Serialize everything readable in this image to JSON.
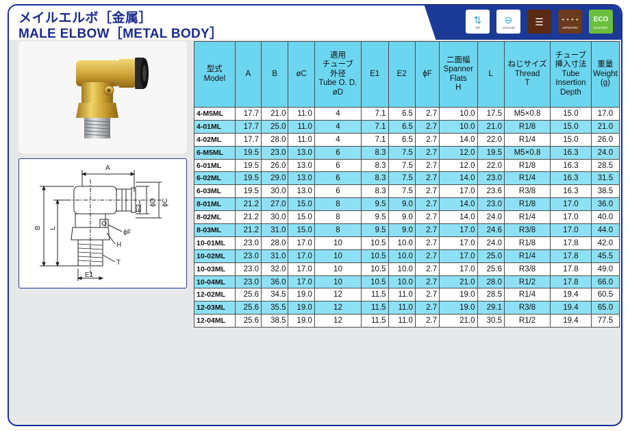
{
  "header": {
    "title_jp": "メイルエルボ［金属］",
    "title_en": "MALE ELBOW［METAL BODY］"
  },
  "icons": [
    {
      "name": "air-icon",
      "label": "AIR"
    },
    {
      "name": "vacuum-icon",
      "label": "VACUUM"
    },
    {
      "name": "multi-icon",
      "label": ""
    },
    {
      "name": "antistatic-icon",
      "label": "ANTISTATIC"
    },
    {
      "name": "ecology-icon",
      "label": "ECOLOGY"
    }
  ],
  "table": {
    "headers": [
      "型式\nModel",
      "A",
      "B",
      "øC",
      "適用\nチューブ\n外径\nTube O. D.\nøD",
      "E1",
      "E2",
      "ϕF",
      "二面幅\nSpanner\nFlats\nH",
      "L",
      "ねじサイズ\nThread\nT",
      "チューブ\n挿入寸法\nTube\nInsertion\nDepth",
      "重量\nWeight\n(g)"
    ],
    "rows": [
      [
        "4-M5ML",
        "17.7",
        "21.0",
        "11.0",
        "4",
        "7.1",
        "6.5",
        "2.7",
        "10.0",
        "17.5",
        "M5×0.8",
        "15.0",
        "17.0"
      ],
      [
        "4-01ML",
        "17.7",
        "25.0",
        "11.0",
        "4",
        "7.1",
        "6.5",
        "2.7",
        "10.0",
        "21.0",
        "R1/8",
        "15.0",
        "21.0"
      ],
      [
        "4-02ML",
        "17.7",
        "28.0",
        "11.0",
        "4",
        "7.1",
        "6.5",
        "2.7",
        "14.0",
        "22.0",
        "R1/4",
        "15.0",
        "26.0"
      ],
      [
        "6-M5ML",
        "19.5",
        "23.0",
        "13.0",
        "6",
        "8.3",
        "7.5",
        "2.7",
        "12.0",
        "19.5",
        "M5×0.8",
        "16.3",
        "24.0"
      ],
      [
        "6-01ML",
        "19.5",
        "26.0",
        "13.0",
        "6",
        "8.3",
        "7.5",
        "2.7",
        "12.0",
        "22.0",
        "R1/8",
        "16.3",
        "28.5"
      ],
      [
        "6-02ML",
        "19.5",
        "29.0",
        "13.0",
        "6",
        "8.3",
        "7.5",
        "2.7",
        "14.0",
        "23.0",
        "R1/4",
        "16.3",
        "31.5"
      ],
      [
        "6-03ML",
        "19.5",
        "30.0",
        "13.0",
        "6",
        "8.3",
        "7.5",
        "2.7",
        "17.0",
        "23.6",
        "R3/8",
        "16.3",
        "38.5"
      ],
      [
        "8-01ML",
        "21.2",
        "27.0",
        "15.0",
        "8",
        "9.5",
        "9.0",
        "2.7",
        "14.0",
        "23.0",
        "R1/8",
        "17.0",
        "36.0"
      ],
      [
        "8-02ML",
        "21.2",
        "30.0",
        "15.0",
        "8",
        "9.5",
        "9.0",
        "2.7",
        "14.0",
        "24.0",
        "R1/4",
        "17.0",
        "40.0"
      ],
      [
        "8-03ML",
        "21.2",
        "31.0",
        "15.0",
        "8",
        "9.5",
        "9.0",
        "2.7",
        "17.0",
        "24.6",
        "R3/8",
        "17.0",
        "44.0"
      ],
      [
        "10-01ML",
        "23.0",
        "28.0",
        "17.0",
        "10",
        "10.5",
        "10.0",
        "2.7",
        "17.0",
        "24.0",
        "R1/8",
        "17.8",
        "42.0"
      ],
      [
        "10-02ML",
        "23.0",
        "31.0",
        "17.0",
        "10",
        "10.5",
        "10.0",
        "2.7",
        "17.0",
        "25.0",
        "R1/4",
        "17.8",
        "45.5"
      ],
      [
        "10-03ML",
        "23.0",
        "32.0",
        "17.0",
        "10",
        "10.5",
        "10.0",
        "2.7",
        "17.0",
        "25.6",
        "R3/8",
        "17.8",
        "49.0"
      ],
      [
        "10-04ML",
        "23.0",
        "36.0",
        "17.0",
        "10",
        "10.5",
        "10.0",
        "2.7",
        "21.0",
        "28.0",
        "R1/2",
        "17.8",
        "66.0"
      ],
      [
        "12-02ML",
        "25.6",
        "34.5",
        "19.0",
        "12",
        "11.5",
        "11.0",
        "2.7",
        "19.0",
        "28.5",
        "R1/4",
        "19.4",
        "60.5"
      ],
      [
        "12-03ML",
        "25.6",
        "35.5",
        "19.0",
        "12",
        "11.5",
        "11.0",
        "2.7",
        "19.0",
        "29.1",
        "R3/8",
        "19.4",
        "65.0"
      ],
      [
        "12-04ML",
        "25.6",
        "38.5",
        "19.0",
        "12",
        "11.5",
        "11.0",
        "2.7",
        "21.0",
        "30.5",
        "R1/2",
        "19.4",
        "77.5"
      ]
    ]
  },
  "drawing": {
    "labels": [
      "A",
      "B",
      "L",
      "E1",
      "E2",
      "ϕC",
      "ϕD",
      "ϕF",
      "H",
      "T"
    ]
  },
  "colors": {
    "brand_blue": "#1b3a96",
    "header_cyan": "#6cd6f0",
    "row_cyan": "#8ee1f5"
  }
}
